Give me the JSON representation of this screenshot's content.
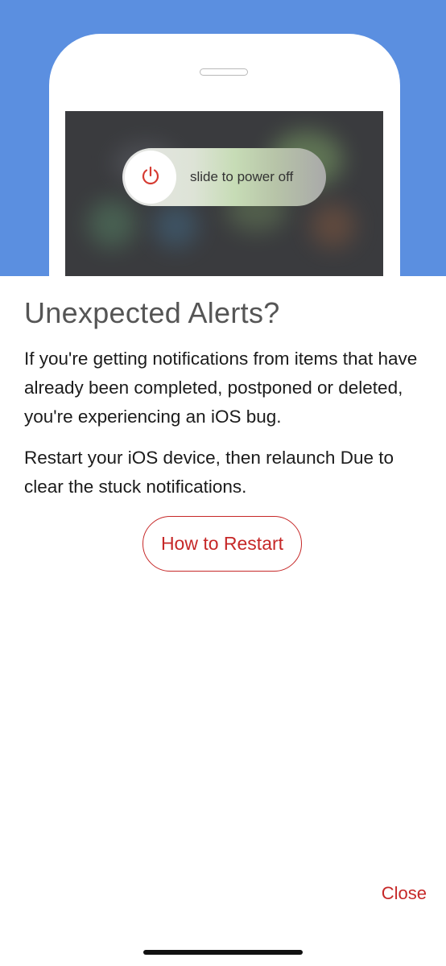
{
  "illustration": {
    "slider_label": "slide to power off",
    "power_icon": "power-icon",
    "background_color": "#5b8fe0"
  },
  "content": {
    "heading": "Unexpected Alerts?",
    "paragraph1": "If you're getting notifications from items that have already been completed, postponed or deleted, you're experiencing an iOS bug.",
    "paragraph2": "Restart your iOS device, then relaunch Due to clear the stuck notifications."
  },
  "actions": {
    "restart_label": "How to Restart",
    "close_label": "Close"
  },
  "colors": {
    "accent": "#c62828"
  }
}
